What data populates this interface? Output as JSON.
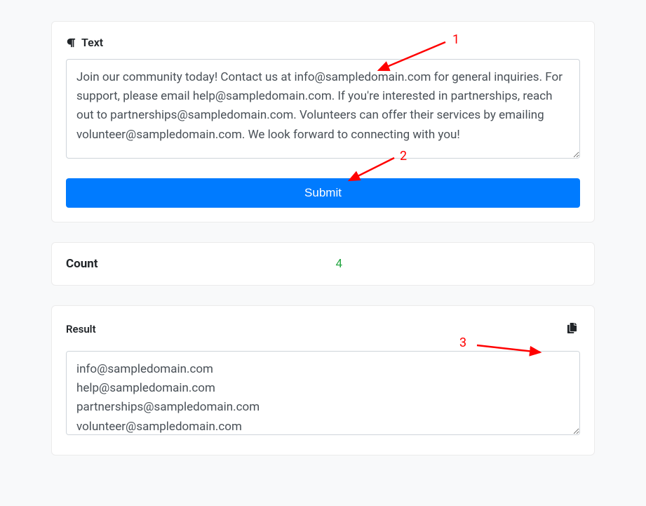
{
  "input": {
    "label": "Text",
    "value": "Join our community today! Contact us at info@sampledomain.com for general inquiries. For support, please email help@sampledomain.com. If you're interested in partnerships, reach out to partnerships@sampledomain.com. Volunteers can offer their services by emailing volunteer@sampledomain.com. We look forward to connecting with you!"
  },
  "submit_label": "Submit",
  "count": {
    "label": "Count",
    "value": "4"
  },
  "result": {
    "label": "Result",
    "value": "info@sampledomain.com\nhelp@sampledomain.com\npartnerships@sampledomain.com\nvolunteer@sampledomain.com"
  },
  "annotations": {
    "n1": "1",
    "n2": "2",
    "n3": "3"
  }
}
